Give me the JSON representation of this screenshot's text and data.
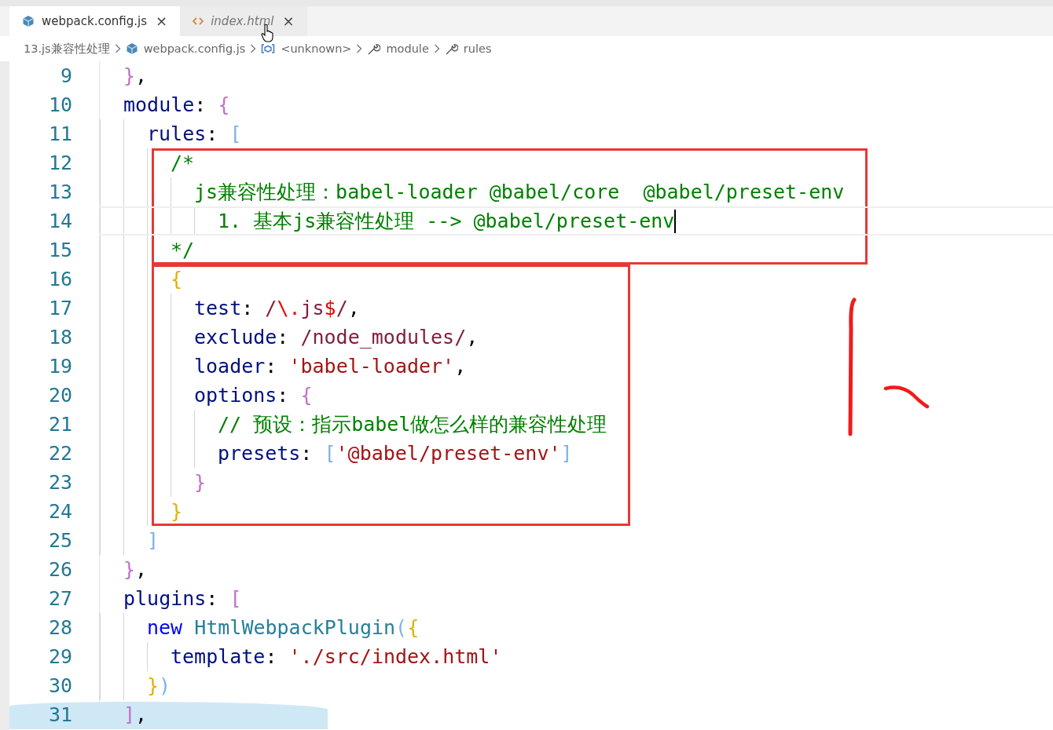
{
  "tabs": [
    {
      "label": "webpack.config.js",
      "kind": "script",
      "selected": true,
      "preview": false,
      "close": "×"
    },
    {
      "label": "index.html",
      "kind": "markup",
      "selected": false,
      "preview": true,
      "close": "×"
    }
  ],
  "breadcrumbs": [
    {
      "label": "13.js兼容性处理",
      "kind": "folder"
    },
    {
      "label": "webpack.config.js",
      "kind": "file"
    },
    {
      "label": "<unknown>",
      "kind": "symbol"
    },
    {
      "label": "module",
      "kind": "property"
    },
    {
      "label": "rules",
      "kind": "property"
    }
  ],
  "editor": {
    "segments": [
      {
        "kind": "plain",
        "lines": [
          {
            "number": "9",
            "tokens": [
              {
                "text": "  }",
                "kind": "brace2"
              },
              {
                "text": ",",
                "kind": "punct"
              }
            ]
          },
          {
            "number": "10",
            "tokens": [
              {
                "text": "  module",
                "kind": "key"
              },
              {
                "text": ": ",
                "kind": "punct"
              },
              {
                "text": "{",
                "kind": "brace2"
              }
            ]
          },
          {
            "number": "11",
            "tokens": [
              {
                "text": "    rules",
                "kind": "key"
              },
              {
                "text": ": ",
                "kind": "punct"
              },
              {
                "text": "[",
                "kind": "brace3"
              }
            ]
          }
        ]
      },
      {
        "kind": "boxed",
        "lines": [
          {
            "number": "12",
            "tokens": [
              {
                "text": "      /*",
                "kind": "comment"
              }
            ]
          },
          {
            "number": "13",
            "tokens": [
              {
                "text": "        js兼容性处理：babel-loader @babel/core  @babel/preset-env",
                "kind": "comment"
              }
            ]
          },
          {
            "number": "14",
            "cursor": true,
            "tokens": [
              {
                "text": "          1. 基本js兼容性处理 --> @babel/preset-env",
                "kind": "comment"
              }
            ]
          },
          {
            "number": "15",
            "tokens": [
              {
                "text": "      */",
                "kind": "comment"
              }
            ]
          }
        ]
      },
      {
        "kind": "boxed",
        "lines": [
          {
            "number": "16",
            "tokens": [
              {
                "text": "      {",
                "kind": "brace1"
              }
            ]
          },
          {
            "number": "17",
            "tokens": [
              {
                "text": "        test",
                "kind": "key"
              },
              {
                "text": ": ",
                "kind": "punct"
              },
              {
                "text": "/",
                "kind": "regex"
              },
              {
                "text": "\\.",
                "kind": "regexop"
              },
              {
                "text": "js",
                "kind": "regex"
              },
              {
                "text": "$",
                "kind": "regexop"
              },
              {
                "text": "/",
                "kind": "regex"
              },
              {
                "text": ",",
                "kind": "punct"
              }
            ]
          },
          {
            "number": "18",
            "tokens": [
              {
                "text": "        exclude",
                "kind": "key"
              },
              {
                "text": ": ",
                "kind": "punct"
              },
              {
                "text": "/node_modules/",
                "kind": "regex"
              },
              {
                "text": ",",
                "kind": "punct"
              }
            ]
          },
          {
            "number": "19",
            "tokens": [
              {
                "text": "        loader",
                "kind": "key"
              },
              {
                "text": ": ",
                "kind": "punct"
              },
              {
                "text": "'babel-loader'",
                "kind": "string"
              },
              {
                "text": ",",
                "kind": "punct"
              }
            ]
          },
          {
            "number": "20",
            "tokens": [
              {
                "text": "        options",
                "kind": "key"
              },
              {
                "text": ": ",
                "kind": "punct"
              },
              {
                "text": "{",
                "kind": "brace2"
              }
            ]
          },
          {
            "number": "21",
            "tokens": [
              {
                "text": "          // 预设：指示babel做怎么样的兼容性处理",
                "kind": "comment"
              }
            ]
          },
          {
            "number": "22",
            "tokens": [
              {
                "text": "          presets",
                "kind": "key"
              },
              {
                "text": ": ",
                "kind": "punct"
              },
              {
                "text": "[",
                "kind": "brace3"
              },
              {
                "text": "'@babel/preset-env'",
                "kind": "string"
              },
              {
                "text": "]",
                "kind": "brace3"
              }
            ]
          },
          {
            "number": "23",
            "tokens": [
              {
                "text": "        }",
                "kind": "brace2"
              }
            ]
          },
          {
            "number": "24",
            "tokens": [
              {
                "text": "      }",
                "kind": "brace1"
              }
            ]
          }
        ]
      },
      {
        "kind": "plain",
        "lines": [
          {
            "number": "25",
            "tokens": [
              {
                "text": "    ]",
                "kind": "brace3"
              }
            ]
          },
          {
            "number": "26",
            "tokens": [
              {
                "text": "  }",
                "kind": "brace2"
              },
              {
                "text": ",",
                "kind": "punct"
              }
            ]
          },
          {
            "number": "27",
            "tokens": [
              {
                "text": "  plugins",
                "kind": "key"
              },
              {
                "text": ": ",
                "kind": "punct"
              },
              {
                "text": "[",
                "kind": "brace2"
              }
            ]
          },
          {
            "number": "28",
            "tokens": [
              {
                "text": "    new",
                "kind": "keyword"
              },
              {
                "text": " HtmlWebpackPlugin",
                "kind": "class"
              },
              {
                "text": "(",
                "kind": "brace3"
              },
              {
                "text": "{",
                "kind": "brace1"
              }
            ]
          },
          {
            "number": "29",
            "tokens": [
              {
                "text": "      template",
                "kind": "key"
              },
              {
                "text": ": ",
                "kind": "punct"
              },
              {
                "text": "'./src/index.html'",
                "kind": "string"
              }
            ]
          },
          {
            "number": "30",
            "tokens": [
              {
                "text": "    }",
                "kind": "brace1"
              },
              {
                "text": ")",
                "kind": "brace3"
              }
            ]
          },
          {
            "number": "31",
            "marked": true,
            "tokens": [
              {
                "text": "  ]",
                "kind": "brace2"
              },
              {
                "text": ",",
                "kind": "punct"
              }
            ]
          }
        ]
      }
    ]
  }
}
